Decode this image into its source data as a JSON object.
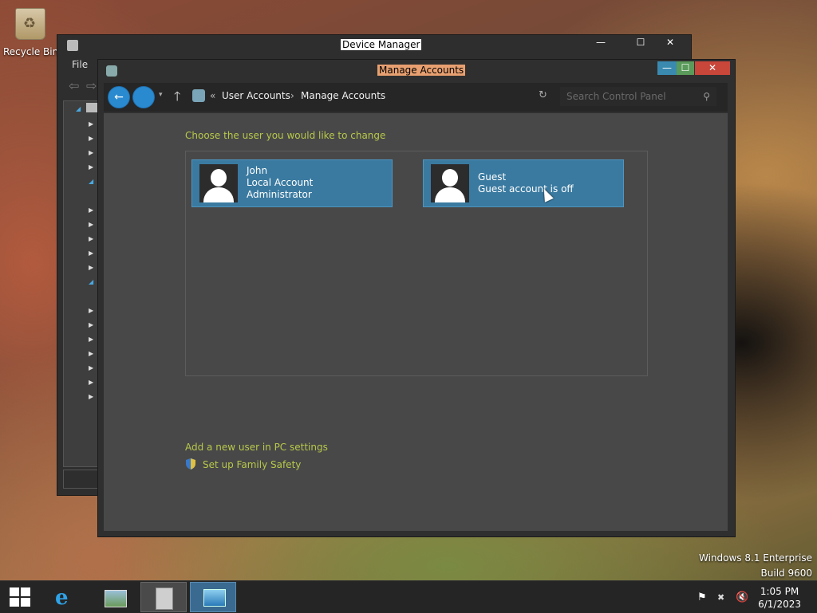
{
  "desktop": {
    "recycle_bin_label": "Recycle Bin"
  },
  "device_manager": {
    "title": "Device Manager",
    "menu_file": "File",
    "min": "—",
    "max": "☐",
    "close": "✕"
  },
  "manage_accounts": {
    "title": "Manage Accounts",
    "min": "—",
    "max": "☐",
    "close": "✕",
    "address": {
      "back_glyph": "←",
      "dropdown_glyph": "▾",
      "up_glyph": "🡑",
      "overflow": "«",
      "crumbs": [
        "User Accounts",
        "Manage Accounts"
      ],
      "separator": "›",
      "refresh_glyph": "↻",
      "search_placeholder": "Search Control Panel",
      "search_glyph": "⚲"
    },
    "heading": "Choose the user you would like to change",
    "accounts": [
      {
        "name": "John",
        "type": "Local Account",
        "role": "Administrator"
      },
      {
        "name": "Guest",
        "status": "Guest account is off"
      }
    ],
    "links": {
      "add_user": "Add a new user in PC settings",
      "family_safety": "Set up Family Safety"
    }
  },
  "watermark": {
    "edition": "Windows 8.1 Enterprise",
    "build": "Build 9600"
  },
  "taskbar": {
    "ie_glyph": "e",
    "tray": {
      "flag": "⚑",
      "network": "✖",
      "volume": "🔇"
    },
    "clock": {
      "time": "1:05 PM",
      "date": "6/1/2023"
    }
  },
  "colors": {
    "link": "#b8c84a",
    "tile": "#3a7aa0",
    "accent": "#2a8ad0"
  }
}
